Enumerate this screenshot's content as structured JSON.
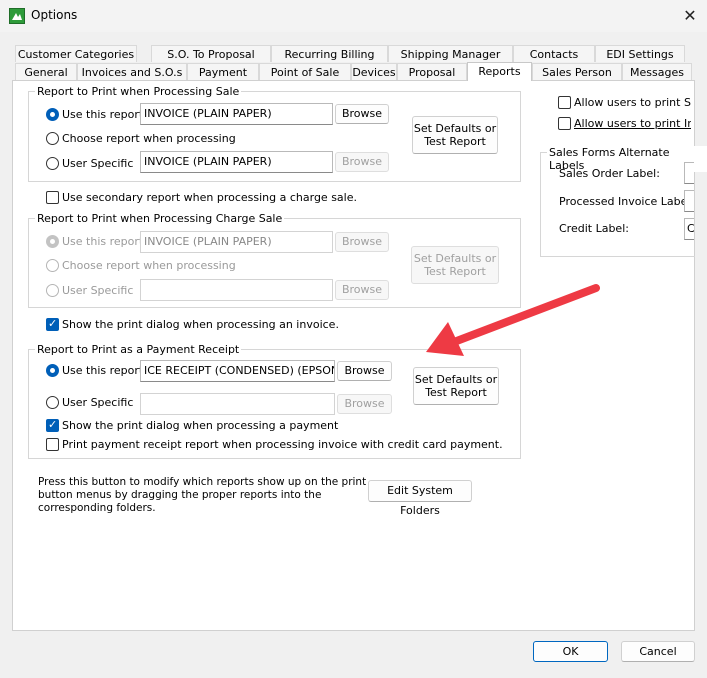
{
  "window": {
    "title": "Options",
    "close_glyph": "✕"
  },
  "tabs_row1": [
    "Customer Categories",
    "S.O. To Proposal",
    "Recurring Billing",
    "Shipping Manager",
    "Contacts",
    "EDI Settings"
  ],
  "tabs_row2": [
    "General",
    "Invoices and S.O.s",
    "Payment",
    "Point of Sale",
    "Devices",
    "Proposal",
    "Reports",
    "Sales Person",
    "Messages"
  ],
  "active_tab": "Reports",
  "sale_group": {
    "label": "Report to Print when Processing Sale",
    "use_this_report": "Use this report",
    "use_value": "INVOICE (PLAIN PAPER)",
    "choose_report": "Choose report when processing",
    "user_specific": "User Specific",
    "user_value": "INVOICE (PLAIN PAPER)",
    "browse": "Browse",
    "set_defaults": "Set Defaults or Test Report"
  },
  "secondary_report": "Use secondary report when processing a charge sale.",
  "charge_group": {
    "label": "Report to Print when Processing Charge Sale",
    "use_this_report": "Use this report",
    "use_value": "INVOICE (PLAIN PAPER)",
    "choose_report": "Choose report when processing",
    "user_specific": "User Specific",
    "user_value": "",
    "browse": "Browse",
    "set_defaults": "Set Defaults or Test Report"
  },
  "show_print_dialog_invoice": "Show the print dialog when processing an invoice.",
  "receipt_group": {
    "label": "Report to Print as a Payment Receipt",
    "use_this_report": "Use this report",
    "use_value": "ICE RECEIPT (CONDENSED) (EPSON)",
    "user_specific": "User Specific",
    "user_value": "",
    "browse": "Browse",
    "set_defaults": "Set Defaults or Test Report",
    "show_dialog": "Show the print dialog when processing a payment",
    "print_cc": "Print payment receipt report when processing invoice with credit card payment."
  },
  "folders_text": "Press this button to modify which reports show up on the print button menus by dragging the proper reports into the corresponding folders.",
  "edit_folders": "Edit System Folders",
  "right": {
    "allow1": "Allow users to print Sales",
    "allow2": "Allow users to print Invoic",
    "alt_labels": "Sales Forms Alternate Labels",
    "sales_order_label": "Sales Order Label:",
    "processed_invoice_label": "Processed Invoice Label:",
    "credit_label": "Credit Label:",
    "credit_value": "C"
  },
  "footer": {
    "ok": "OK",
    "cancel": "Cancel"
  },
  "colors": {
    "accent": "#005fb8",
    "arrow": "#ee3a44"
  }
}
